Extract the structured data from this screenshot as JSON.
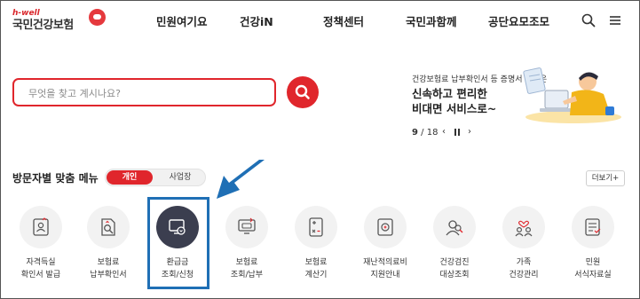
{
  "logo": {
    "tagline": "h-well",
    "name": "국민건강보험"
  },
  "nav": {
    "items": [
      "민원여기요",
      "건강iN",
      "정책센터",
      "국민과함께",
      "공단요모조모"
    ]
  },
  "header_icons": [
    "search-icon",
    "hamburger-menu-icon"
  ],
  "search": {
    "placeholder": "무엇을 찾고 계시나요?",
    "value": ""
  },
  "banner": {
    "subtitle": "건강보험료 납부확인서 등 증명서 발급은",
    "headline_line1": "신속하고 편리한",
    "headline_line2": "비대면 서비스로~",
    "current": "9",
    "total": "18"
  },
  "section": {
    "title": "방문자별 맞춤 메뉴",
    "toggle_active": "개인",
    "toggle_inactive": "사업장",
    "more": "더보기+"
  },
  "menu": [
    {
      "line1": "자격득실",
      "line2": "확인서 발급",
      "icon": "id-card-icon"
    },
    {
      "line1": "보험료",
      "line2": "납부확인서",
      "icon": "document-search-icon"
    },
    {
      "line1": "환급금",
      "line2": "조회/신청",
      "icon": "monitor-refund-icon",
      "active": true
    },
    {
      "line1": "보험료",
      "line2": "조회/납부",
      "icon": "monitor-payment-icon"
    },
    {
      "line1": "보험료",
      "line2": "계산기",
      "icon": "calculator-icon"
    },
    {
      "line1": "재난적의료비",
      "line2": "지원안내",
      "icon": "medical-support-icon"
    },
    {
      "line1": "건강검진",
      "line2": "대상조회",
      "icon": "health-check-icon"
    },
    {
      "line1": "가족",
      "line2": "건강관리",
      "icon": "family-health-icon"
    },
    {
      "line1": "민원",
      "line2": "서식자료실",
      "icon": "form-archive-icon"
    }
  ],
  "colors": {
    "accent": "#e0262c",
    "highlight": "#1f6fb5",
    "active_icon_bg": "#3b3e4f"
  }
}
